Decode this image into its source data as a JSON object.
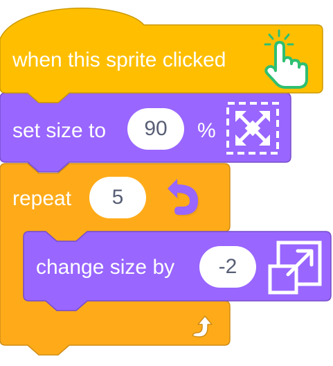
{
  "colors": {
    "events": "#FFBF00",
    "events_border": "#CC9900",
    "looks": "#9966FF",
    "looks_border": "#774DCB",
    "control": "#FFAB19",
    "control_border": "#CF8B17",
    "hand_icon": "#2FBF71"
  },
  "hat_block": {
    "label": "when this sprite clicked",
    "icon": "pointing-hand-icon"
  },
  "set_size_block": {
    "label": "set size to",
    "value": "90",
    "unit": "%",
    "icon": "fullscreen-arrows-icon"
  },
  "repeat_block": {
    "label": "repeat",
    "value": "5",
    "icon": "loop-arrow-icon",
    "footer_icon": "repeat-arrow-icon"
  },
  "change_size_block": {
    "label": "change size by",
    "value": "-2",
    "icon": "resize-expand-icon"
  }
}
